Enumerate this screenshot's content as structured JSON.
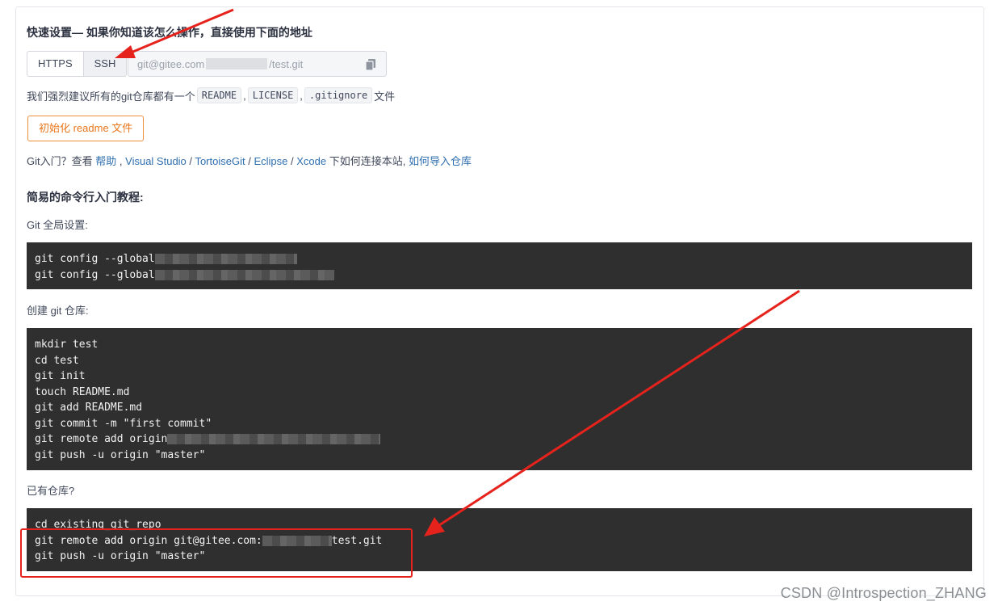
{
  "quick_setup": {
    "title": "快速设置— 如果你知道该怎么操作，直接使用下面的地址",
    "protocols": [
      "HTTPS",
      "SSH"
    ],
    "active_protocol": "SSH",
    "url_prefix": "git@gitee.com",
    "url_suffix": "/test.git"
  },
  "readme_hint": {
    "prefix": "我们强烈建议所有的git仓库都有一个",
    "files": [
      "README",
      "LICENSE",
      ".gitignore"
    ],
    "separator": ",",
    "suffix": "文件"
  },
  "init_button": "初始化 readme 文件",
  "help": {
    "prefix": "Git入门？查看",
    "help_link": "帮助",
    "sep1": ",",
    "links": [
      "Visual Studio",
      "TortoiseGit",
      "Eclipse",
      "Xcode"
    ],
    "slash": "/",
    "middle": "下如何连接本站,",
    "import_link": "如何导入仓库"
  },
  "tutorial": {
    "title": "简易的命令行入门教程:",
    "global_label": "Git 全局设置:",
    "global_cmds": [
      "git config --global",
      "git config --global"
    ],
    "create_label": "创建 git 仓库:",
    "create_cmds": [
      "mkdir test",
      "cd test",
      "git init",
      "touch README.md",
      "git add README.md",
      "git commit -m \"first commit\"",
      "git remote add origin",
      "git push -u origin \"master\""
    ],
    "existing_label": "已有仓库?",
    "existing_cmds": [
      "cd existing_git_repo",
      "git remote add origin git@gitee.com:",
      "test.git",
      "git push -u origin \"master\""
    ]
  },
  "watermark": "CSDN @Introspection_ZHANG",
  "colors": {
    "accent_orange": "#e8771e",
    "link_blue": "#2f6fb0",
    "code_bg": "#2f2f2f",
    "annotation_red": "#e5231c"
  }
}
